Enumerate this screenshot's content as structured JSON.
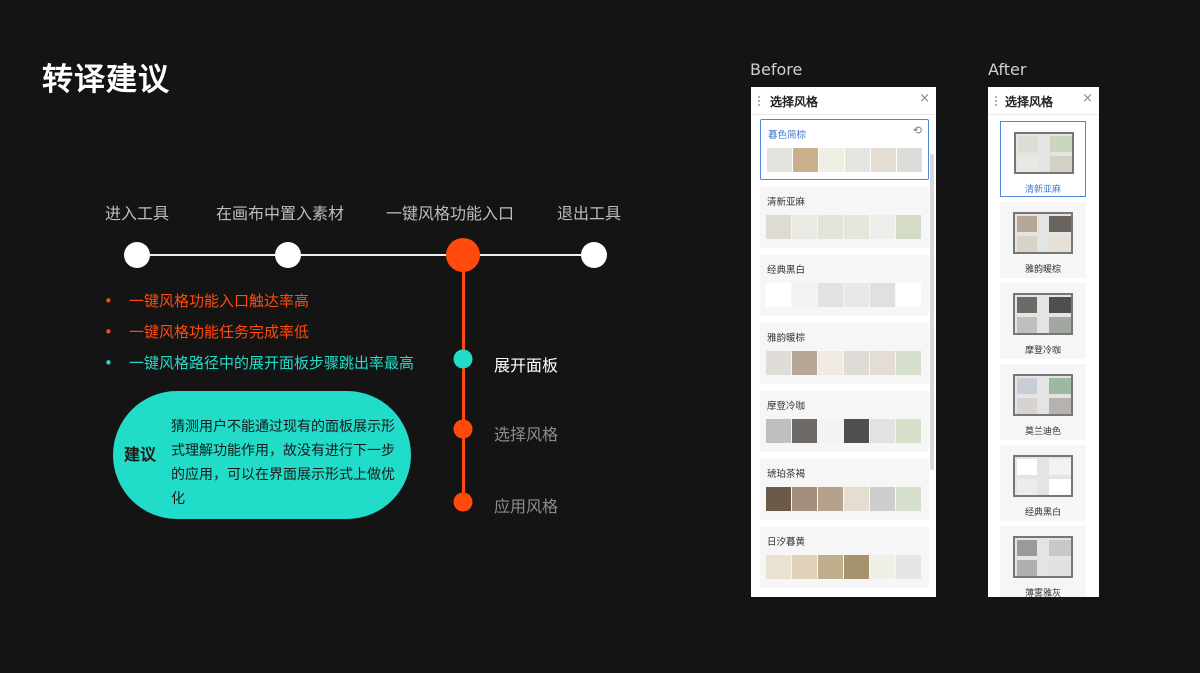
{
  "title": "转译建议",
  "colors": {
    "accent": "#ff4a0c",
    "cyan": "#22dcca",
    "muted": "#8c8c8c"
  },
  "timeline": {
    "steps": [
      "进入工具",
      "在画布中置入素材",
      "一键风格功能入口",
      "退出工具"
    ],
    "substeps": [
      "展开面板",
      "选择风格",
      "应用风格"
    ]
  },
  "bullets": [
    {
      "text": "一键风格功能入口触达率高"
    },
    {
      "text": "一键风格功能任务完成率低"
    },
    {
      "text": "一键风格路径中的展开面板步骤跳出率最高"
    }
  ],
  "suggestion": {
    "tag": "建议",
    "text": "猜测用户不能通过现有的面板展示形式理解功能作用，故没有进行下一步的应用，可以在界面展示形式上做优化"
  },
  "before": {
    "caption": "Before",
    "panel_title": "选择风格",
    "close": "×",
    "reset": "⟲",
    "styles": [
      {
        "name": "暮色简棕",
        "swatches": [
          "#e4e2dd",
          "#c9b08a",
          "#f0ede3",
          "#e6e6e0",
          "#e3ddd2",
          "#dcdcd8"
        ]
      },
      {
        "name": "清新亚麻",
        "swatches": [
          "#dedbd3",
          "#ebe9e4",
          "#e2e4d8",
          "#e5e5dc",
          "#eeeeea",
          "#d4dcc8"
        ]
      },
      {
        "name": "经典黑白",
        "swatches": [
          "#ffffff",
          "#f2f2f2",
          "#e2e2e2",
          "#e8e8e8",
          "#e0e0e0",
          "#ffffff"
        ]
      },
      {
        "name": "雅韵暖棕",
        "swatches": [
          "#e0ddd8",
          "#b5a695",
          "#efebe2",
          "#dedad5",
          "#e4ddd5",
          "#d6dfcb"
        ]
      },
      {
        "name": "摩登冷咖",
        "swatches": [
          "#bfbfbf",
          "#6d6a66",
          "#f3f3f3",
          "#4f4f4f",
          "#e2e2e2",
          "#d6dfcb"
        ]
      },
      {
        "name": "琥珀茶褐",
        "swatches": [
          "#6b5a4a",
          "#a38f7b",
          "#b5a18c",
          "#e5ddcf",
          "#cdcdcd",
          "#d6dfcb"
        ]
      },
      {
        "name": "日汐暮黄",
        "swatches": [
          "#e9e2d1",
          "#dfd2b8",
          "#bfaf8d",
          "#a6936d",
          "#f0efe8",
          "#e6e6e6"
        ]
      }
    ]
  },
  "after": {
    "caption": "After",
    "panel_title": "选择风格",
    "close": "×",
    "styles": [
      {
        "name": "清新亚麻",
        "colors": [
          "#dedbd3",
          "#c9d6be",
          "#e9e7e1",
          "#d4d0c8"
        ]
      },
      {
        "name": "雅韵暖棕",
        "colors": [
          "#b5a695",
          "#6b6560",
          "#d9d2c8",
          "#e6dfd6"
        ]
      },
      {
        "name": "摩登冷咖",
        "colors": [
          "#6d6a66",
          "#4f4f4f",
          "#bfbfbf",
          "#a0a8a0"
        ]
      },
      {
        "name": "莫兰迪色",
        "colors": [
          "#c8ccd6",
          "#9fb8a0",
          "#d6d3d0",
          "#b8b2ae"
        ]
      },
      {
        "name": "经典黑白",
        "colors": [
          "#ffffff",
          "#f2f2f2",
          "#ececec",
          "#ffffff"
        ]
      },
      {
        "name": "薄雾雅灰",
        "colors": [
          "#9a9a9a",
          "#c8c8c8",
          "#b0b0b0",
          "#e0e0e0"
        ]
      }
    ]
  }
}
